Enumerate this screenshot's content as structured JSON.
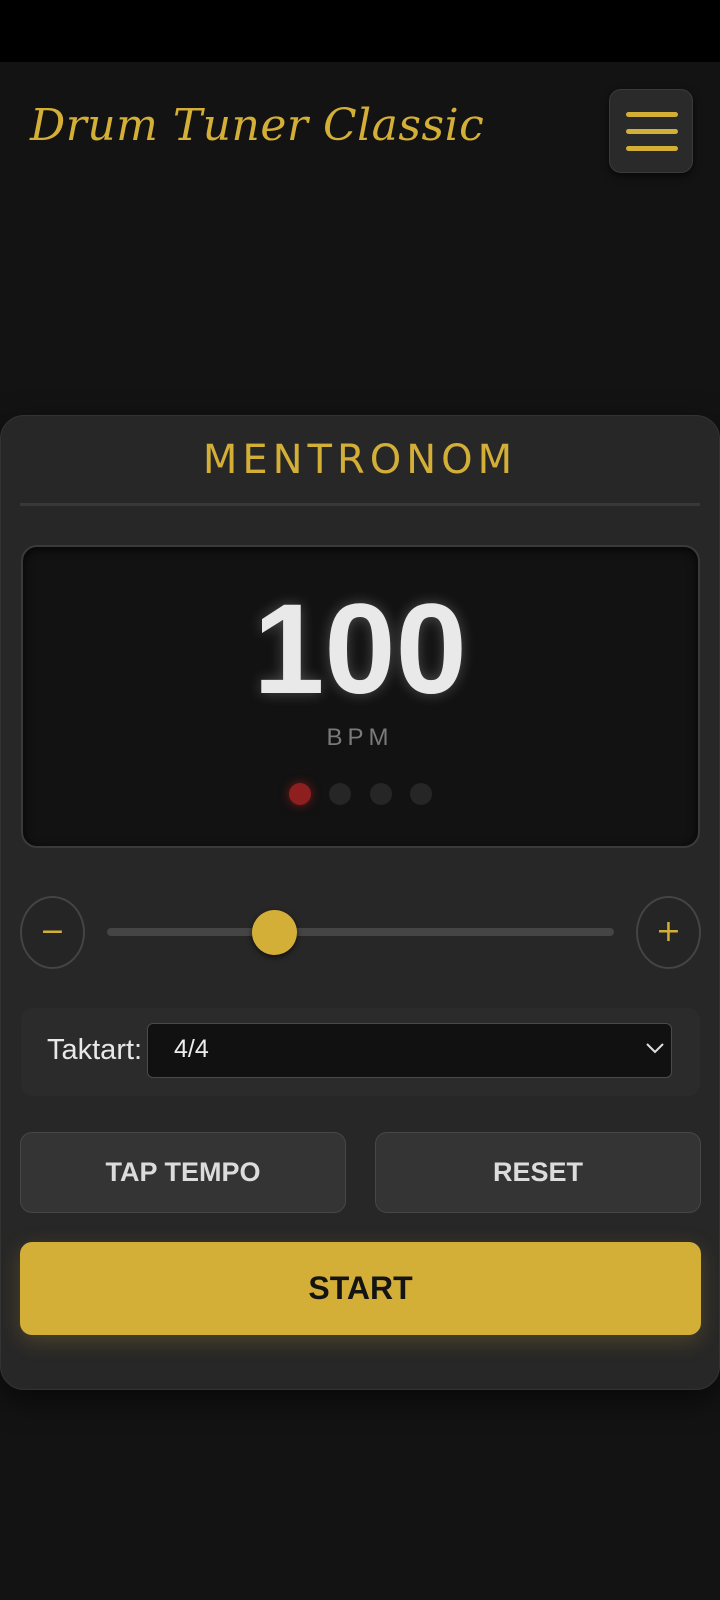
{
  "header": {
    "app_title": "Drum Tuner Classic",
    "menu_icon": "hamburger-menu-icon"
  },
  "metronome": {
    "title": "MENTRONOM",
    "bpm_value": "100",
    "bpm_unit": "BPM",
    "beats": {
      "count": 4,
      "active_index": 0
    },
    "tempo_slider": {
      "value": 100,
      "min": 40,
      "max": 300,
      "fraction": 0.33
    },
    "decrease_label": "−",
    "increase_label": "+",
    "time_signature": {
      "label": "Taktart:",
      "selected": "4/4"
    },
    "tap_tempo_label": "TAP TEMPO",
    "reset_label": "RESET",
    "start_label": "START"
  },
  "colors": {
    "accent": "#d4af37",
    "background": "#131313",
    "card": "#272727",
    "active_beat": "#8e1f1f"
  }
}
